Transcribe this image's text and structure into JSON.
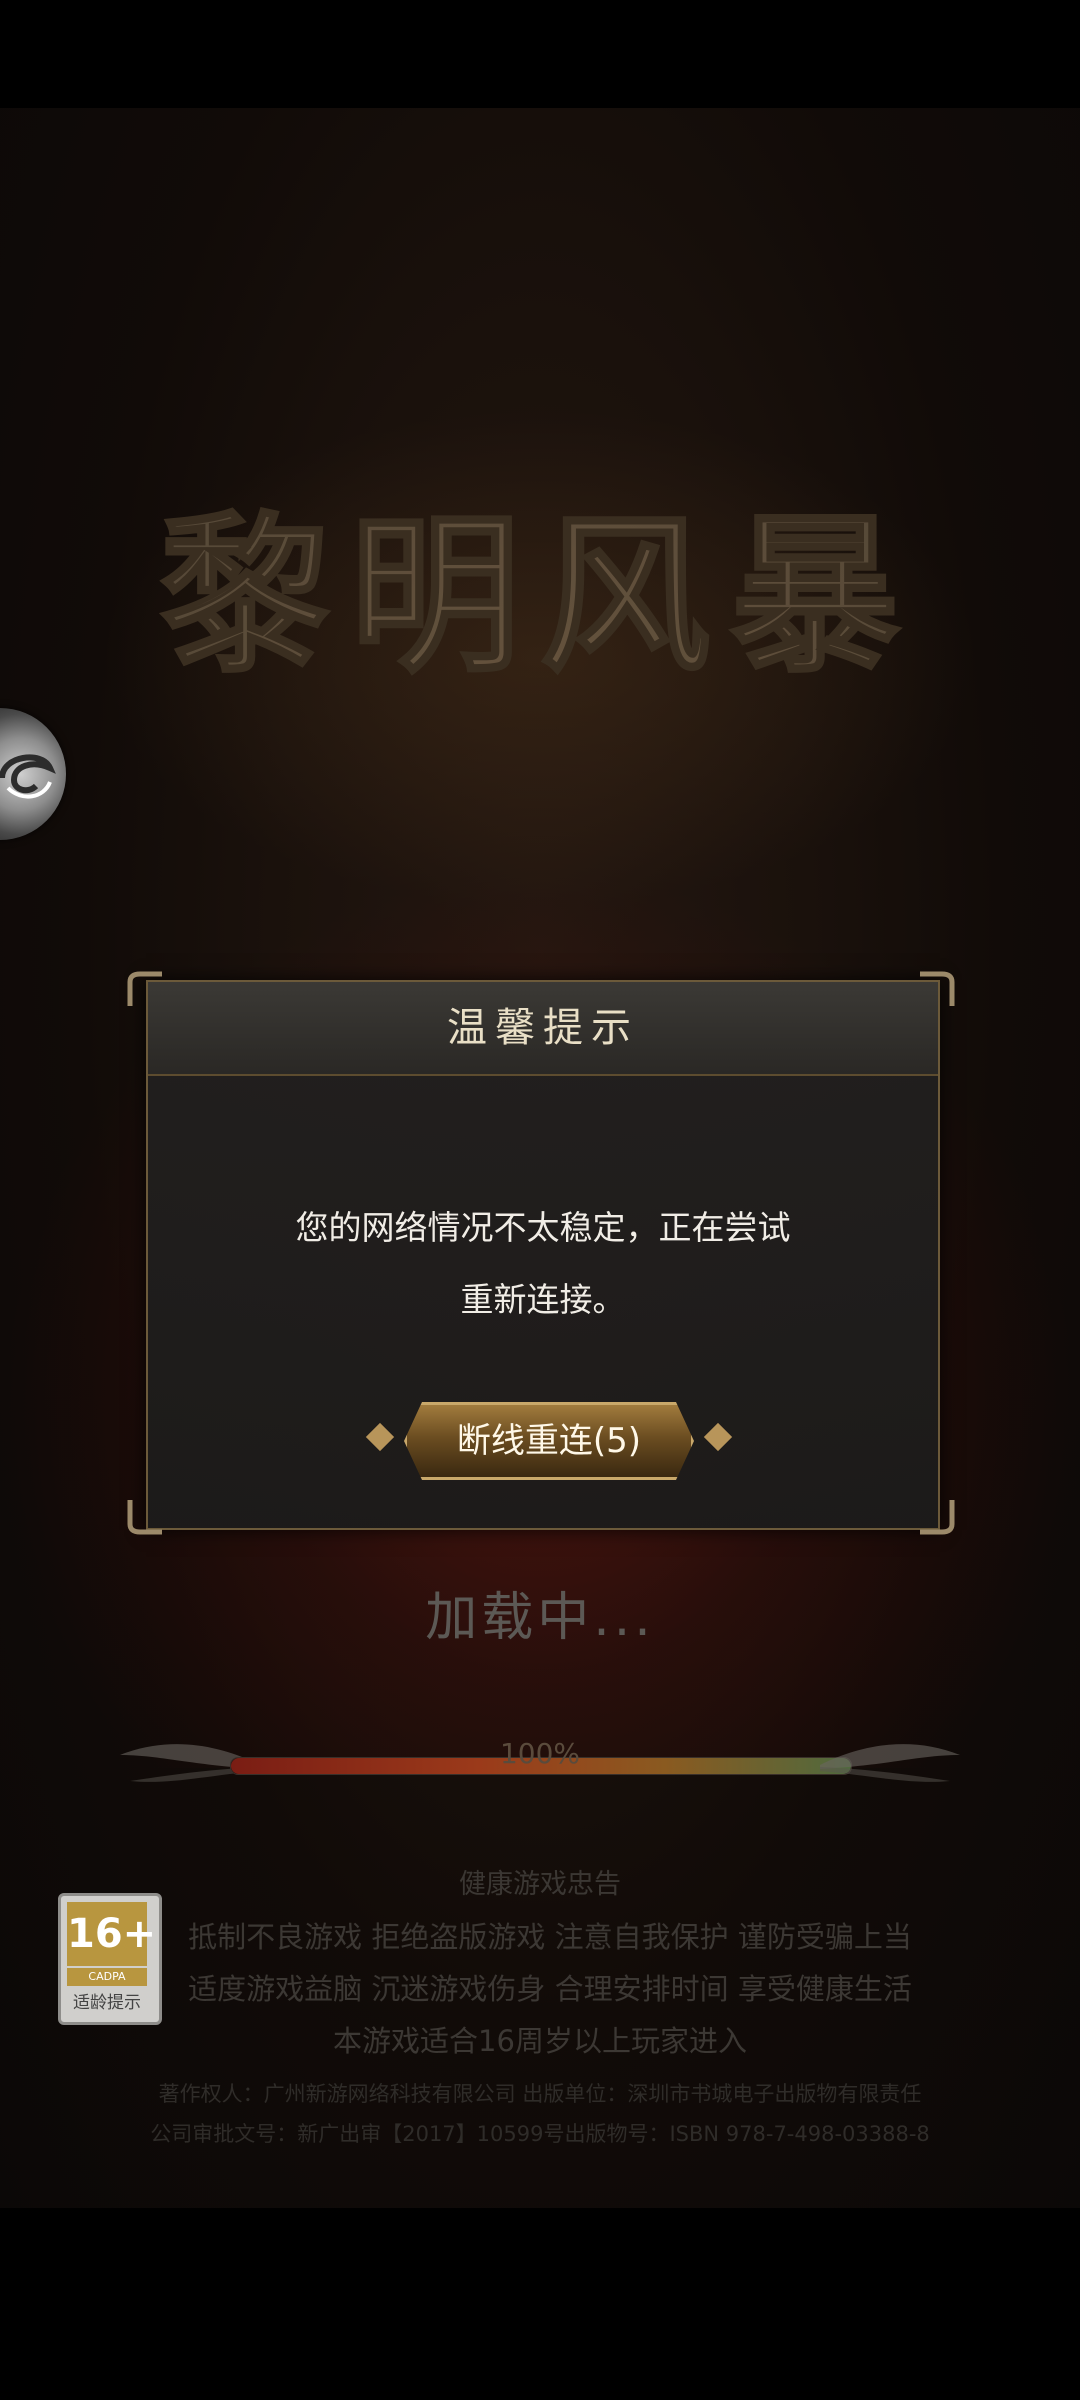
{
  "game": {
    "logo_text": "黎明风暴"
  },
  "dialog": {
    "title": "温馨提示",
    "message_line1": "您的网络情况不太稳定，正在尝试",
    "message_line2": "重新连接。",
    "button_label": "断线重连(5)"
  },
  "loading": {
    "text": "加载中...",
    "progress_label": "100%",
    "progress_fraction": 1.0
  },
  "age_rating": {
    "age": "16+",
    "org": "CADPA",
    "tip": "适龄提示"
  },
  "health_notice": {
    "title": "健康游戏忠告",
    "line1": "抵制不良游戏  拒绝盗版游戏  注意自我保护  谨防受骗上当",
    "line2": "适度游戏益脑  沉迷游戏伤身  合理安排时间  享受健康生活",
    "line3": "本游戏适合16周岁以上玩家进入"
  },
  "copyright": {
    "line1": "著作权人：广州新游网络科技有限公司 出版单位：深圳市书城电子出版物有限责任",
    "line2": "公司审批文号：新广出审【2017】10599号出版物号：ISBN 978-7-498-03388-8"
  }
}
